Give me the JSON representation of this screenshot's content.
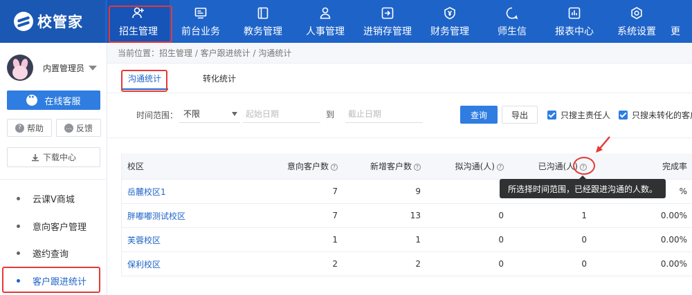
{
  "app": {
    "logo_text": "校管家"
  },
  "nav": [
    {
      "label": "招生管理",
      "icon": "person-add-icon",
      "active": true
    },
    {
      "label": "前台业务",
      "icon": "monitor-icon"
    },
    {
      "label": "教务管理",
      "icon": "book-icon"
    },
    {
      "label": "人事管理",
      "icon": "person-icon"
    },
    {
      "label": "进销存管理",
      "icon": "inventory-icon"
    },
    {
      "label": "财务管理",
      "icon": "finance-icon"
    },
    {
      "label": "师生信",
      "icon": "chat-icon"
    },
    {
      "label": "报表中心",
      "icon": "report-icon"
    },
    {
      "label": "系统设置",
      "icon": "settings-icon"
    },
    {
      "label": "更"
    }
  ],
  "sidebar": {
    "user_name": "内置管理员",
    "service_label": "在线客服",
    "help_label": "帮助",
    "feedback_label": "反馈",
    "download_label": "下载中心",
    "items": [
      {
        "label": "云课V商城"
      },
      {
        "label": "意向客户管理"
      },
      {
        "label": "邀约查询"
      },
      {
        "label": "客户跟进统计",
        "active": true
      }
    ]
  },
  "breadcrumb": "当前位置：招生管理 / 客户跟进统计 / 沟通统计",
  "tabs": [
    {
      "label": "沟通统计",
      "active": true
    },
    {
      "label": "转化统计"
    }
  ],
  "filters": {
    "range_label": "时间范围：",
    "range_value": "不限",
    "start_placeholder": "起始日期",
    "to_label": "到",
    "end_placeholder": "截止日期",
    "search_label": "查询",
    "export_label": "导出",
    "only_owner_label": "只搜主责任人",
    "only_unconverted_label": "只搜未转化的客户"
  },
  "table": {
    "headers": [
      "校区",
      "意向客户数",
      "新增客户数",
      "拟沟通(人)",
      "已沟通(人)",
      "完成率"
    ],
    "rows": [
      {
        "campus": "岳麓校区1",
        "intent": "7",
        "new": "9",
        "plan": "",
        "done": "",
        "rate": "%"
      },
      {
        "campus": "胖嘟嘟测试校区",
        "intent": "7",
        "new": "13",
        "plan": "0",
        "done": "1",
        "rate": "0.00%"
      },
      {
        "campus": "芙蓉校区",
        "intent": "1",
        "new": "1",
        "plan": "0",
        "done": "0",
        "rate": "0.00%"
      },
      {
        "campus": "保利校区",
        "intent": "2",
        "new": "2",
        "plan": "0",
        "done": "0",
        "rate": "0.00%"
      }
    ]
  },
  "tooltip": "所选择时间范围，已经跟进沟通的人数。",
  "colors": {
    "nav_bg": "#1e63c8",
    "accent": "#2f7de1",
    "highlight": "#e53935"
  }
}
